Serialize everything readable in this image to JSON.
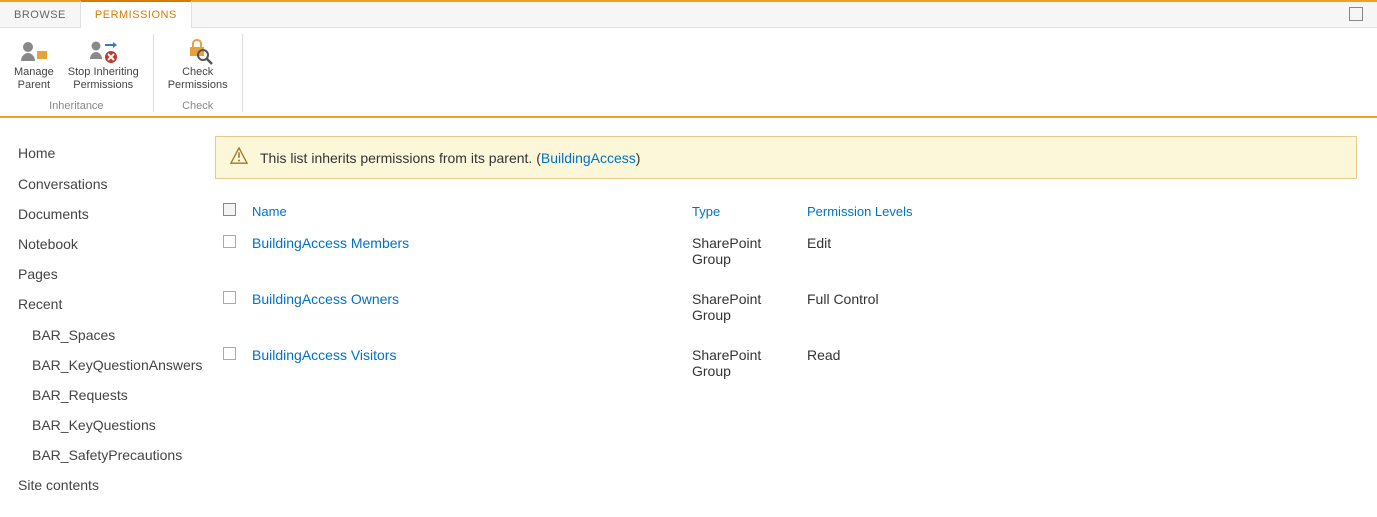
{
  "tabs": {
    "browse": "BROWSE",
    "permissions": "PERMISSIONS"
  },
  "ribbon": {
    "manage_parent_l1": "Manage",
    "manage_parent_l2": "Parent",
    "stop_inh_l1": "Stop Inheriting",
    "stop_inh_l2": "Permissions",
    "check_perm_l1": "Check",
    "check_perm_l2": "Permissions",
    "group_inheritance": "Inheritance",
    "group_check": "Check"
  },
  "sidebar": {
    "home": "Home",
    "conversations": "Conversations",
    "documents": "Documents",
    "notebook": "Notebook",
    "pages": "Pages",
    "recent": "Recent",
    "recent_items": {
      "spaces": "BAR_Spaces",
      "kqa": "BAR_KeyQuestionAnswers",
      "requests": "BAR_Requests",
      "kq": "BAR_KeyQuestions",
      "safety": "BAR_SafetyPrecautions"
    },
    "site_contents": "Site contents"
  },
  "notice": {
    "text": "This list inherits permissions from its parent. (",
    "link": "BuildingAccess",
    "close": ")"
  },
  "columns": {
    "name": "Name",
    "type": "Type",
    "levels": "Permission Levels"
  },
  "rows": [
    {
      "name": "BuildingAccess Members",
      "type": "SharePoint Group",
      "level": "Edit"
    },
    {
      "name": "BuildingAccess Owners",
      "type": "SharePoint Group",
      "level": "Full Control"
    },
    {
      "name": "BuildingAccess Visitors",
      "type": "SharePoint Group",
      "level": "Read"
    }
  ]
}
